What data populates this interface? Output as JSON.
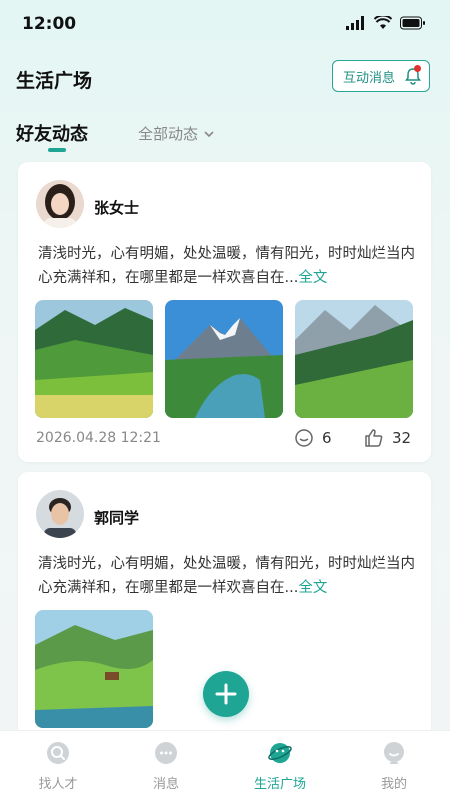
{
  "status": {
    "time": "12:00"
  },
  "header": {
    "title": "生活广场",
    "interact_label": "互动消息"
  },
  "tabs": {
    "friends": "好友动态",
    "all": "全部动态"
  },
  "posts": [
    {
      "author": "张女士",
      "text": "清浅时光，心有明媚，处处温暖，情有阳光，时时灿烂当内心充满祥和，在哪里都是一样欢喜自在...",
      "more": "全文",
      "time": "2026.04.28 12:21",
      "comments": "6",
      "likes": "32"
    },
    {
      "author": "郭同学",
      "text": "清浅时光，心有明媚，处处温暖，情有阳光，时时灿烂当内心充满祥和，在哪里都是一样欢喜自在...",
      "more": "全文"
    }
  ],
  "tabbar": {
    "items": [
      {
        "label": "找人才",
        "icon": "search-person-icon"
      },
      {
        "label": "消息",
        "icon": "chat-bubble-icon"
      },
      {
        "label": "生活广场",
        "icon": "planet-icon"
      },
      {
        "label": "我的",
        "icon": "profile-icon"
      }
    ],
    "active": "生活广场"
  },
  "colors": {
    "accent": "#1fa594",
    "badge": "#e2302c"
  }
}
